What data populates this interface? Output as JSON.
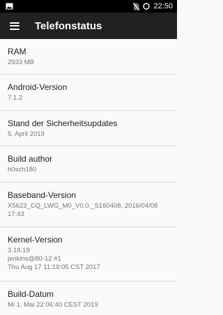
{
  "statusbar": {
    "time": "22:50"
  },
  "appbar": {
    "title": "Telefonstatus"
  },
  "items": [
    {
      "label": "RAM",
      "value": "2933 MB"
    },
    {
      "label": "Android-Version",
      "value": "7.1.2"
    },
    {
      "label": "Stand der Sicherheitsupdates",
      "value": "5. April 2019"
    },
    {
      "label": "Build author",
      "value": "h0sch180"
    },
    {
      "label": "Baseband-Version",
      "value": "X5623_CQ_LWG_M0_V0.0._S160408, 2016/04/08\n17:43"
    },
    {
      "label": "Kernel-Version",
      "value": "3.18.19\njenkins@80-12 #1\nThu Aug 17 11:19:05 CST 2017"
    },
    {
      "label": "Build-Datum",
      "value": "Mi 1. Mai 22:06:40 CEST 2019"
    }
  ]
}
